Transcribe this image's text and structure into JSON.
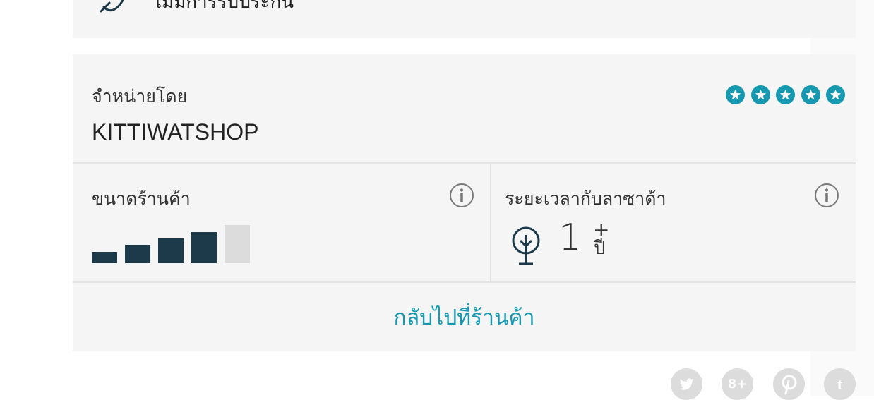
{
  "warranty": {
    "text": "ไม่มีการรับประกัน"
  },
  "seller": {
    "sold_by_label": "จำหน่ายโดย",
    "name": "KITTIWATSHOP",
    "rating_stars": 5,
    "rating_color": "#1698b1"
  },
  "shop_size": {
    "label": "ขนาดร้านค้า",
    "level": 4,
    "max_level": 5,
    "filled_color": "#1c3a4a",
    "empty_color": "#dcdcdc"
  },
  "time_on_lazada": {
    "label": "ระยะเวลากับลาซาด้า",
    "value": "1",
    "plus": "+",
    "unit": "ปี"
  },
  "back_to_shop": "กลับไปที่ร้านค้า",
  "social": [
    {
      "name": "twitter",
      "glyph": ""
    },
    {
      "name": "google-plus",
      "glyph": "8+"
    },
    {
      "name": "pinterest",
      "glyph": ""
    },
    {
      "name": "tumblr",
      "glyph": "t"
    }
  ]
}
